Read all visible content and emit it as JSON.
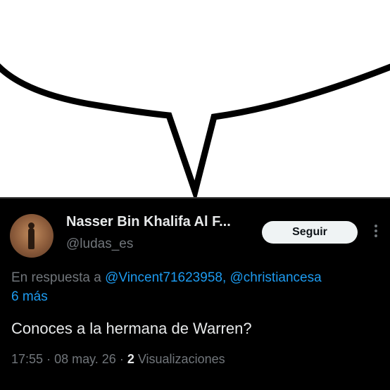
{
  "tweet": {
    "display_name": "Nasser Bin Khalifa Al F...",
    "handle": "@ludas_es",
    "follow_label": "Seguir",
    "reply_prefix": "En respuesta a",
    "mention_1": "@Vincent71623958,",
    "mention_2": "@christiancesa",
    "more_mentions": "6 más",
    "text": "Conoces a la hermana de Warren?",
    "time": "17:55",
    "date": "08 may. 26",
    "views_count": "2",
    "views_label": "Visualizaciones",
    "separator": "·"
  },
  "colors": {
    "background": "#000000",
    "text_primary": "#e7e9ea",
    "text_secondary": "#71767b",
    "link": "#1d9bf0",
    "follow_button_bg": "#eff3f4"
  },
  "icons": {
    "more": "more-vertical-icon"
  }
}
